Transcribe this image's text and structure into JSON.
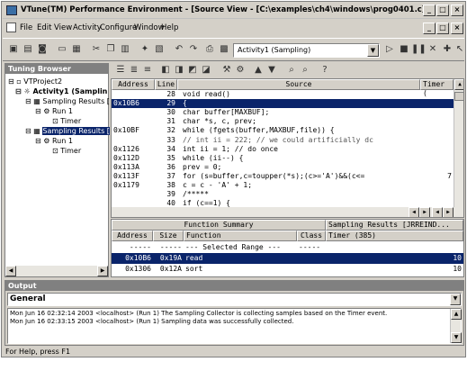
{
  "window": {
    "title": "VTune(TM) Performance Environment - [Source View - [C:\\examples\\ch4\\windows\\prog0401.c]]",
    "min": "_",
    "max": "□",
    "close": "×"
  },
  "menu": [
    "File",
    "Edit",
    "View",
    "Activity",
    "Configure",
    "Window",
    "Help"
  ],
  "toolbar": {
    "activity_combo": "Activity1 (Sampling)"
  },
  "tree": {
    "title": "Tuning Browser",
    "items": [
      {
        "label": "VTProject2",
        "level": 0
      },
      {
        "label": "Activity1 (Samplin",
        "level": 1,
        "bold": true
      },
      {
        "label": "Sampling Results [",
        "level": 2
      },
      {
        "label": "Run 1",
        "level": 3
      },
      {
        "label": "Timer",
        "level": 4
      },
      {
        "label": "Sampling Results [",
        "level": 2,
        "selected": true
      },
      {
        "label": "Run 1",
        "level": 3
      },
      {
        "label": "Timer",
        "level": 4
      }
    ]
  },
  "source": {
    "headers": {
      "address": "Address",
      "line": "Line",
      "source": "Source",
      "timer": "Timer ("
    },
    "rows": [
      {
        "addr": "",
        "line": "28",
        "code": "void read()",
        "timer": ""
      },
      {
        "addr": "0x10B6",
        "line": "29",
        "code": "{",
        "timer": "",
        "selected": true
      },
      {
        "addr": "",
        "line": "30",
        "code": "  char buffer[MAXBUF];",
        "timer": ""
      },
      {
        "addr": "",
        "line": "31",
        "code": "  char *s, c, prev;",
        "timer": ""
      },
      {
        "addr": "0x10BF",
        "line": "32",
        "code": "  while (fgets(buffer,MAXBUF,file)) {",
        "timer": ""
      },
      {
        "addr": "",
        "line": "33",
        "code": "    // int ii = 222; // we could artificially dc",
        "timer": "",
        "comment": true
      },
      {
        "addr": "0x1126",
        "line": "34",
        "code": "    int ii = 1; // do once",
        "timer": ""
      },
      {
        "addr": "0x112D",
        "line": "35",
        "code": "    while (ii--) {",
        "timer": ""
      },
      {
        "addr": "0x113A",
        "line": "36",
        "code": "      prev = 0;",
        "timer": ""
      },
      {
        "addr": "0x113F",
        "line": "37",
        "code": "      for (s=buffer,c=toupper(*s);(c>='A')&&(c<=",
        "timer": "7"
      },
      {
        "addr": "0x1179",
        "line": "38",
        "code": "      c = c - 'A' + 1;",
        "timer": ""
      },
      {
        "addr": "",
        "line": "39",
        "code": "      /*****",
        "timer": ""
      },
      {
        "addr": "",
        "line": "40",
        "code": "          if (c==1) {",
        "timer": ""
      }
    ]
  },
  "function_summary": {
    "title": "Function Summary",
    "sampling_title": "Sampling Results [JRREIND...",
    "headers": {
      "address": "Address",
      "size": "Size",
      "function": "Function",
      "class": "Class",
      "timer": "Timer (385)"
    },
    "rows": [
      {
        "addr": "-----",
        "size": "-----",
        "function": "--- Selected Range ---",
        "class": "-----",
        "timer": ""
      },
      {
        "addr": "0x10B6",
        "size": "0x19A",
        "function": "read",
        "class": "",
        "timer": "10",
        "selected": true
      },
      {
        "addr": "0x1306",
        "size": "0x12A",
        "function": "sort",
        "class": "",
        "timer": "10"
      }
    ]
  },
  "output": {
    "title": "Output",
    "combo": "General",
    "lines": [
      "Mon Jun 16 02:32:14 2003 <localhost> (Run 1) The Sampling Collector is collecting samples based on the Timer event.",
      "Mon Jun 16 02:33:15 2003 <localhost> (Run 1) Sampling data was successfully collected."
    ]
  },
  "statusbar": "For Help, press F1"
}
